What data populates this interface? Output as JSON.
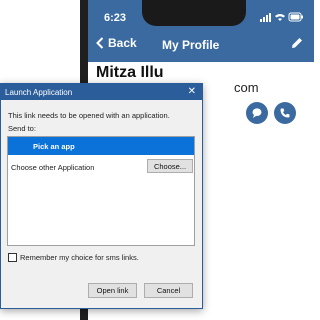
{
  "phone": {
    "status_time": "6:23",
    "nav_back_label": "Back",
    "nav_title": "My Profile",
    "profile_name": "Mitza Illu",
    "profile_email_tail": "com"
  },
  "dialog": {
    "title": "Launch Application",
    "close_glyph": "✕",
    "message": "This link needs to be opened with an application.",
    "send_to_label": "Send to:",
    "apps": [
      {
        "label": "Pick an app",
        "selected": true
      },
      {
        "label": "Choose other Application",
        "selected": false
      }
    ],
    "choose_button": "Choose...",
    "remember_label": "Remember my choice for sms links.",
    "remember_checked": false,
    "open_button": "Open link",
    "cancel_button": "Cancel"
  },
  "colors": {
    "brand_blue": "#3b6aa0",
    "titlebar_blue": "#2a5d9a",
    "selection_blue": "#0a72d8"
  }
}
